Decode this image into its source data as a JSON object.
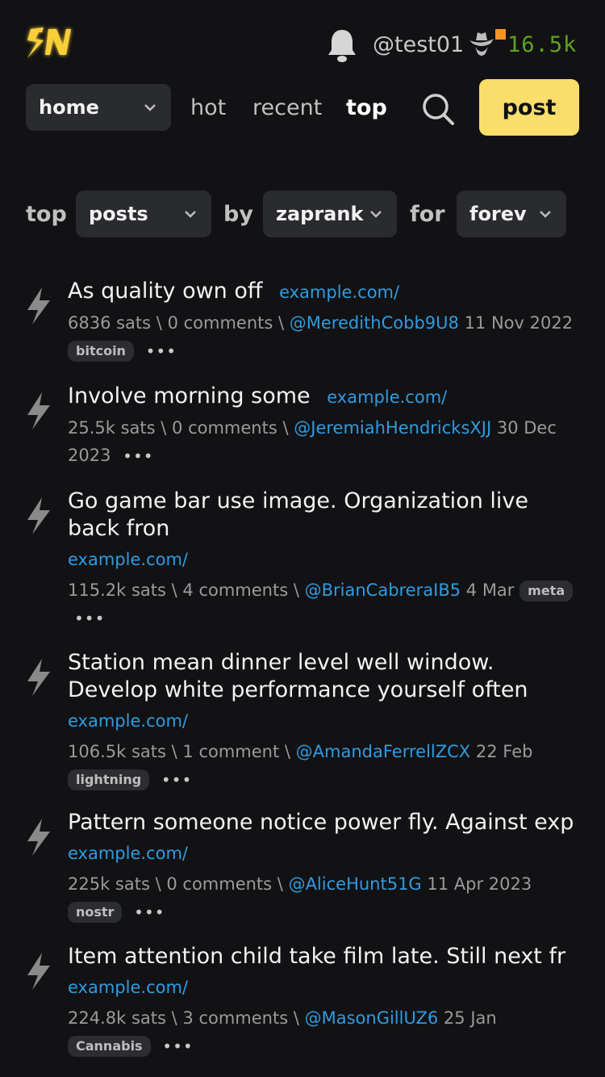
{
  "header": {
    "logo_text": "SN",
    "username": "@test01",
    "sats_balance": "16.5k"
  },
  "nav": {
    "sub_select": "home",
    "links": [
      "hot",
      "recent",
      "top"
    ],
    "active": "top",
    "post_label": "post"
  },
  "filters": {
    "top_label": "top",
    "what": "posts",
    "by_label": "by",
    "by": "zaprank",
    "for_label": "for",
    "when": "forev"
  },
  "items": [
    {
      "title": "As quality own off",
      "link": "example.com/",
      "sats": "6836 sats",
      "comments": "0 comments",
      "user": "@MeredithCobb9U8",
      "date": "11 Nov 2022",
      "tag": "bitcoin"
    },
    {
      "title": "Involve morning some",
      "link": "example.com/",
      "sats": "25.5k sats",
      "comments": "0 comments",
      "user": "@JeremiahHendricksXJJ",
      "date": "30 Dec 2023",
      "tag": ""
    },
    {
      "title": "Go game bar use image. Organization live back fron",
      "link": "example.com/",
      "sats": "115.2k sats",
      "comments": "4 comments",
      "user": "@BrianCabreraIB5",
      "date": "4 Mar",
      "tag": "meta"
    },
    {
      "title": "Station mean dinner level well window. Develop white performance yourself often",
      "link": "example.com/",
      "sats": "106.5k sats",
      "comments": "1 comment",
      "user": "@AmandaFerrellZCX",
      "date": "22 Feb",
      "tag": "lightning"
    },
    {
      "title": "Pattern someone notice power fly. Against exp",
      "link": "example.com/",
      "sats": "225k sats",
      "comments": "0 comments",
      "user": "@AliceHunt51G",
      "date": "11 Apr 2023",
      "tag": "nostr"
    },
    {
      "title": "Item attention child take film late. Still next fr",
      "link": "example.com/",
      "sats": "224.8k sats",
      "comments": "3 comments",
      "user": "@MasonGillUZ6",
      "date": "25 Jan",
      "tag": "Cannabis"
    }
  ],
  "separator": "\\",
  "more_glyph": "•••",
  "colors": {
    "accent": "#fade6b",
    "link": "#2f9be0",
    "sats": "#5ea320",
    "background": "#121214"
  }
}
